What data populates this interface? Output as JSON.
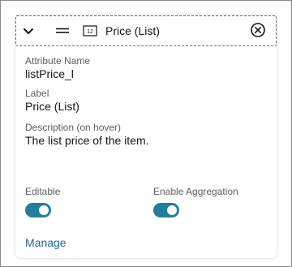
{
  "header": {
    "title": "Price (List)",
    "type_icon_text": "12",
    "icons": {
      "collapse": "chevron-down-icon",
      "drag": "drag-handle-icon",
      "type": "number-type-icon",
      "remove": "close-circle-icon"
    }
  },
  "fields": {
    "attribute_name_label": "Attribute Name",
    "attribute_name_value": "listPrice_l",
    "label_label": "Label",
    "label_value": "Price (List)",
    "description_label": "Description (on hover)",
    "description_value": "The list price of the item."
  },
  "toggles": {
    "editable_label": "Editable",
    "editable_on": true,
    "aggregation_label": "Enable Aggregation",
    "aggregation_on": true
  },
  "manage_link": "Manage",
  "colors": {
    "accent": "#227e9e",
    "link": "#1f6a8b"
  }
}
